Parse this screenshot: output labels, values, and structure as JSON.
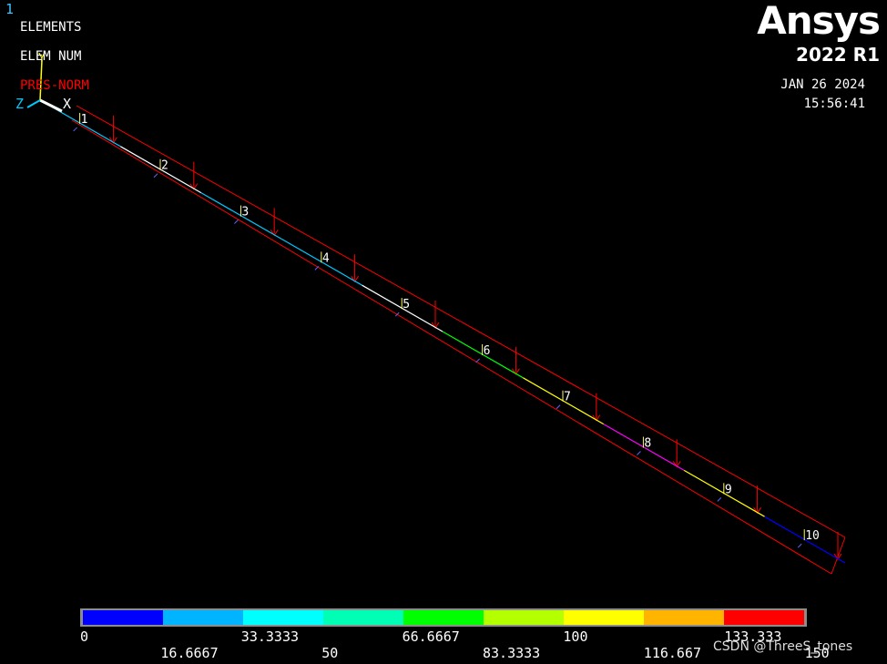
{
  "window_number": "1",
  "plot_labels": {
    "line1": "ELEMENTS",
    "line2": "ELEM NUM",
    "line3": "PRES-NORM"
  },
  "brand": {
    "name": "Ansys",
    "version": "2022 R1"
  },
  "timestamp": {
    "date": "JAN 26 2024",
    "time": "15:56:41"
  },
  "triad": {
    "x_label": "X",
    "y_label": "Y",
    "z_label": "Z",
    "colors": {
      "x": "#ffffff",
      "y": "#ffff00",
      "z": "#00c8ff"
    }
  },
  "elements": {
    "numbers": [
      "1",
      "2",
      "3",
      "4",
      "5",
      "6",
      "7",
      "8",
      "9",
      "10"
    ],
    "beam_segment_colors": [
      "#00c8ff",
      "#ffffff",
      "#00c8ff",
      "#00c8ff",
      "#ffffff",
      "#00ff00",
      "#ffff00",
      "#ff00ff",
      "#ffff00",
      "#0000ff"
    ],
    "pressure_color": "#ff0000"
  },
  "legend": {
    "colors": [
      "#0000ff",
      "#00b4ff",
      "#00ffff",
      "#00ffb4",
      "#00ff00",
      "#b4ff00",
      "#ffff00",
      "#ffb400",
      "#ff0000"
    ],
    "top_labels": [
      "0",
      "33.3333",
      "66.6667",
      "100",
      "133.333"
    ],
    "bottom_labels": [
      "16.6667",
      "50",
      "83.3333",
      "116.667",
      "150"
    ]
  },
  "watermark": "CSDN @ThreeS_tones"
}
